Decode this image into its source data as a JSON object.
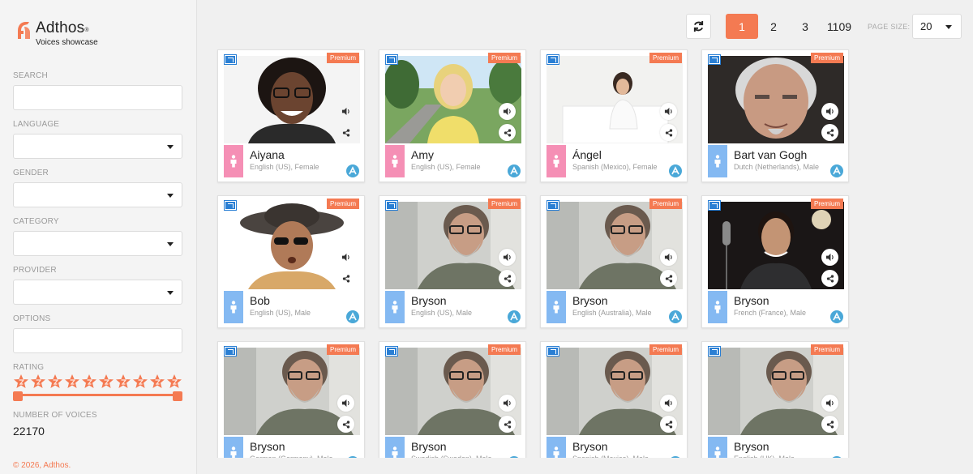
{
  "brand": {
    "name": "Adthos",
    "mark": "®",
    "tagline": "Voices showcase"
  },
  "filters": {
    "search_label": "SEARCH",
    "language_label": "LANGUAGE",
    "gender_label": "GENDER",
    "category_label": "CATEGORY",
    "provider_label": "PROVIDER",
    "options_label": "OPTIONS",
    "rating_label": "RATING",
    "voices_label": "NUMBER OF VOICES",
    "voices_count": "22170"
  },
  "rating": {
    "stars": 10,
    "min": 0,
    "max": 10,
    "star_color": "#f47a52"
  },
  "copyright": "© 2026, Adthos.",
  "pagination": {
    "pages": [
      "1",
      "2",
      "3",
      "1109"
    ],
    "active": "1",
    "page_size_label": "PAGE SIZE:",
    "page_size": "20"
  },
  "accent": "#f47a52",
  "cards": [
    {
      "name": "Aiyana",
      "meta": "English (US), Female",
      "gender": "female",
      "badge": "Premium",
      "photo": "woman-glasses"
    },
    {
      "name": "Amy",
      "meta": "English (US), Female",
      "gender": "female",
      "badge": "Premium",
      "photo": "blonde-park"
    },
    {
      "name": "Ángel",
      "meta": "Spanish (Mexico), Female",
      "gender": "female",
      "badge": "Premium",
      "photo": "woman-sofa"
    },
    {
      "name": "Bart van Gogh",
      "meta": "Dutch (Netherlands), Male",
      "gender": "male",
      "badge": "Premium",
      "photo": "old-man"
    },
    {
      "name": "Bob",
      "meta": "English (US), Male",
      "gender": "male",
      "badge": "Premium",
      "photo": "hat-man"
    },
    {
      "name": "Bryson",
      "meta": "English (US), Male",
      "gender": "male",
      "badge": "Premium",
      "photo": "bearded-man"
    },
    {
      "name": "Bryson",
      "meta": "English (Australia), Male",
      "gender": "male",
      "badge": "Premium",
      "photo": "bearded-man"
    },
    {
      "name": "Bryson",
      "meta": "French (France), Male",
      "gender": "male",
      "badge": "Premium",
      "photo": "studio-man"
    },
    {
      "name": "Bryson",
      "meta": "German (Germany), Male",
      "gender": "male",
      "badge": "Premium",
      "photo": "bearded-man"
    },
    {
      "name": "Bryson",
      "meta": "Swedish (Sweden), Male",
      "gender": "male",
      "badge": "Premium",
      "photo": "bearded-man"
    },
    {
      "name": "Bryson",
      "meta": "Spanish (Mexico), Male",
      "gender": "male",
      "badge": "Premium",
      "photo": "bearded-man"
    },
    {
      "name": "Bryson",
      "meta": "English (UK), Male",
      "gender": "male",
      "badge": "Premium",
      "photo": "bearded-man"
    }
  ]
}
